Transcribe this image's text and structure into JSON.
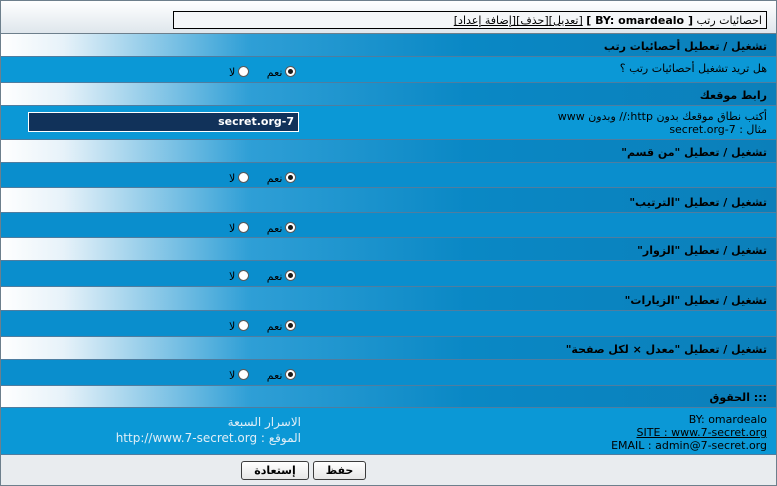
{
  "header": {
    "name": "احصائيات رتب",
    "by": "[ BY: omardealo ]",
    "links": [
      "[تعديل]",
      "[حذف]",
      "[إضافة إعداد]"
    ]
  },
  "sections": [
    {
      "title": "تشغيل / تعطيل أحصائيات رتب",
      "question": "هل تريد تشغيل أحصائيات رتب ؟",
      "yes": "نعم",
      "no": "لا",
      "selected": "yes"
    },
    {
      "title": "رابط موقعك",
      "hint_line1": "أكتب نطاق موقعك بدون http:// وبدون www",
      "hint_line2": "مثال : secret.org-7",
      "value": "secret.org-7"
    },
    {
      "title": "تشغيل / تعطيل \"من قسم\"",
      "yes": "نعم",
      "no": "لا",
      "selected": "yes"
    },
    {
      "title": "تشغيل / تعطيل \"الترتيب\"",
      "yes": "نعم",
      "no": "لا",
      "selected": "yes"
    },
    {
      "title": "تشغيل / تعطيل \"الزوار\"",
      "yes": "نعم",
      "no": "لا",
      "selected": "yes"
    },
    {
      "title": "تشغيل / تعطيل \"الزيارات\"",
      "yes": "نعم",
      "no": "لا",
      "selected": "yes"
    },
    {
      "title": "تشغيل / تعطيل \"معدل × لكل صفحة\"",
      "yes": "نعم",
      "no": "لا",
      "selected": "yes"
    },
    {
      "title": "::: الحقوق"
    }
  ],
  "credits": {
    "by": "BY: omardealo",
    "site": "SITE : www.7-secret.org",
    "email": "EMAIL : admin@7-secret.org",
    "ar_name": "الاسرار السبعة",
    "ar_site": "الموقع : http://www.7-secret.org"
  },
  "buttons": {
    "save": "حفظ",
    "reset": "إستعادة"
  }
}
